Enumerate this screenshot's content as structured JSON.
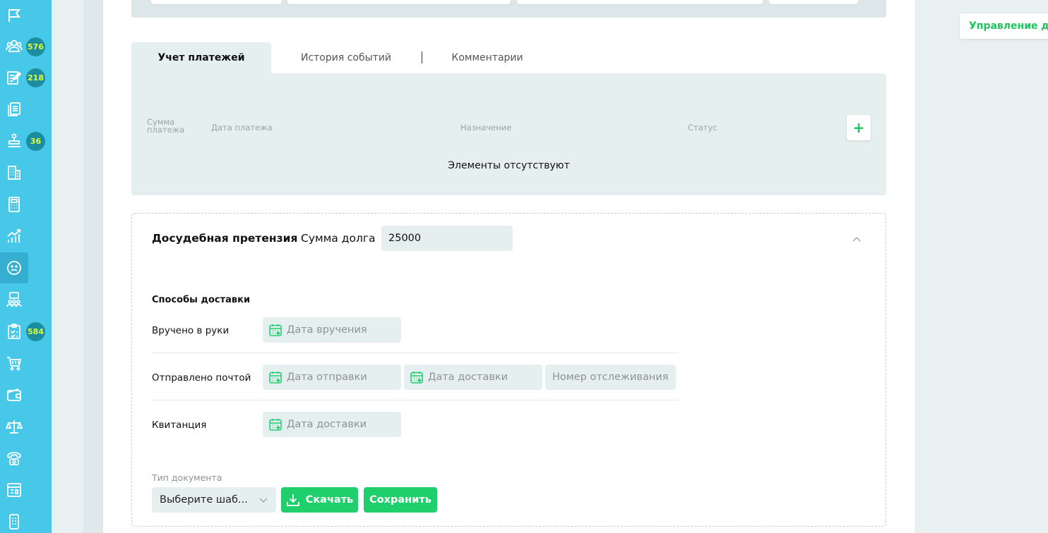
{
  "sidebar": {
    "badges": {
      "clients": "576",
      "tasks": "218",
      "court": "36",
      "checklist": "584"
    }
  },
  "tabs": [
    {
      "label": "Учет платежей",
      "active": true
    },
    {
      "label": "История событий",
      "active": false
    },
    {
      "label": "Комментарии",
      "active": false
    }
  ],
  "payments": {
    "columns": [
      "Сумма платежа",
      "Дата платежа",
      "Назначение",
      "Статус"
    ],
    "add_label": "+",
    "empty_message": "Элементы отсутствуют"
  },
  "claim": {
    "title": "Досудебная претензия",
    "sum_label": "Сумма долга",
    "sum_value": "25000",
    "delivery_title": "Способы доставки",
    "rows": [
      {
        "label": "Вручено в руки",
        "fields": [
          "Дата вручения"
        ]
      },
      {
        "label": "Отправлено почтой",
        "fields": [
          "Дата отправки",
          "Дата доставки",
          "Номер отслеживания"
        ]
      },
      {
        "label": "Квитанция",
        "fields": [
          "Дата доставки"
        ]
      }
    ],
    "doc_type_label": "Тип документа",
    "doc_type_placeholder": "Выберите шаб...",
    "download_label": "Скачать",
    "save_label": "Сохранить"
  },
  "right_panel": {
    "management_label": "Управление до"
  },
  "colors": {
    "sidebar": "#48c8e8",
    "badge": "#1c8ea0",
    "badge_text": "#d9ff3f",
    "accent_green": "#1fcf6b"
  }
}
